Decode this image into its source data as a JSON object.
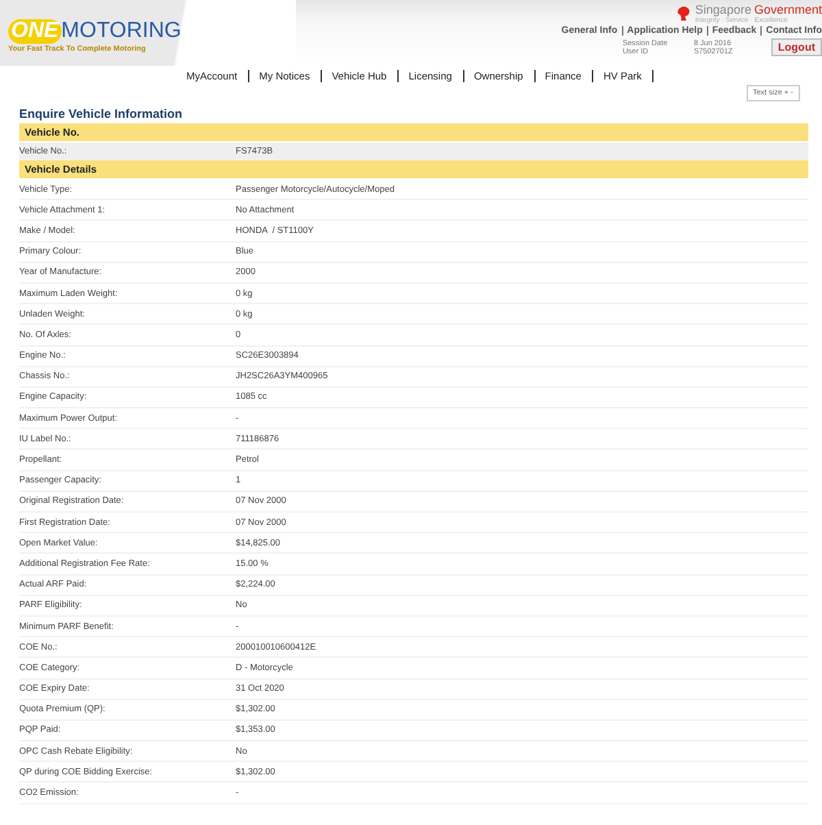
{
  "logo": {
    "one": "ONE",
    "motoring": "MOTORING",
    "tagline": "Your Fast Track To Complete Motoring"
  },
  "gov": {
    "singapore": "Singapore",
    "government": "Government",
    "motto": "Integrity · Service · Excellence"
  },
  "top_links": [
    "General Info",
    "Application Help",
    "Feedback",
    "Contact Info"
  ],
  "session": [
    {
      "label": "Session Date",
      "value": "8 Jun 2016"
    },
    {
      "label": "User ID",
      "value": "S7502701Z"
    }
  ],
  "logout": "Logout",
  "nav": [
    "MyAccount",
    "My Notices",
    "Vehicle Hub",
    "Licensing",
    "Ownership",
    "Finance",
    "HV Park"
  ],
  "text_size": "Text size + -",
  "title": "Enquire Vehicle Information",
  "rows": [
    {
      "kind": "section",
      "label": "Vehicle No."
    },
    {
      "kind": "field",
      "label": "Vehicle No.:",
      "value": "FS7473B"
    },
    {
      "kind": "section",
      "label": "Vehicle Details"
    },
    {
      "kind": "field",
      "label": "Vehicle Type:",
      "value": "Passenger Motorcycle/Autocycle/Moped"
    },
    {
      "kind": "field",
      "label": "Vehicle Attachment 1:",
      "value": "No Attachment"
    },
    {
      "kind": "field",
      "label": "Make / Model:",
      "value": "HONDA  / ST1100Y"
    },
    {
      "kind": "field",
      "label": "Primary Colour:",
      "value": "Blue"
    },
    {
      "kind": "field",
      "label": "Year of Manufacture:",
      "value": "2000"
    },
    {
      "kind": "field",
      "label": "Maximum Laden Weight:",
      "value": "0 kg"
    },
    {
      "kind": "field",
      "label": "Unladen Weight:",
      "value": "0 kg"
    },
    {
      "kind": "field",
      "label": "No. Of Axles:",
      "value": "0"
    },
    {
      "kind": "field",
      "label": "Engine No.:",
      "value": "SC26E3003894"
    },
    {
      "kind": "field",
      "label": "Chassis No.:",
      "value": "JH2SC26A3YM400965"
    },
    {
      "kind": "field",
      "label": "Engine Capacity:",
      "value": "1085 cc"
    },
    {
      "kind": "field",
      "label": "Maximum Power Output:",
      "value": "-"
    },
    {
      "kind": "field",
      "label": "IU Label No.:",
      "value": "711186876"
    },
    {
      "kind": "field",
      "label": "Propellant:",
      "value": "Petrol"
    },
    {
      "kind": "field",
      "label": "Passenger Capacity:",
      "value": "1"
    },
    {
      "kind": "field",
      "label": "Original Registration Date:",
      "value": "07 Nov 2000"
    },
    {
      "kind": "field",
      "label": "First Registration Date:",
      "value": "07 Nov 2000"
    },
    {
      "kind": "field",
      "label": "Open Market Value:",
      "value": "$14,825.00"
    },
    {
      "kind": "field",
      "label": "Additional Registration Fee Rate:",
      "value": "15.00 %"
    },
    {
      "kind": "field",
      "label": "Actual ARF Paid:",
      "value": "$2,224.00"
    },
    {
      "kind": "field",
      "label": "PARF Eligibility:",
      "value": "No"
    },
    {
      "kind": "field",
      "label": "Minimum PARF Benefit:",
      "value": "-"
    },
    {
      "kind": "field",
      "label": "COE No.:",
      "value": "200010010600412E"
    },
    {
      "kind": "field",
      "label": "COE Category:",
      "value": "D - Motorcycle"
    },
    {
      "kind": "field",
      "label": "COE Expiry Date:",
      "value": "31 Oct 2020"
    },
    {
      "kind": "field",
      "label": "Quota Premium (QP):",
      "value": "$1,302.00"
    },
    {
      "kind": "field",
      "label": "PQP Paid:",
      "value": "$1,353.00"
    },
    {
      "kind": "field",
      "label": "OPC Cash Rebate Eligibility:",
      "value": "No"
    },
    {
      "kind": "field",
      "label": "QP during COE Bidding Exercise:",
      "value": "$1,302.00"
    },
    {
      "kind": "field",
      "label": "CO2 Emission:",
      "value": "-"
    }
  ]
}
